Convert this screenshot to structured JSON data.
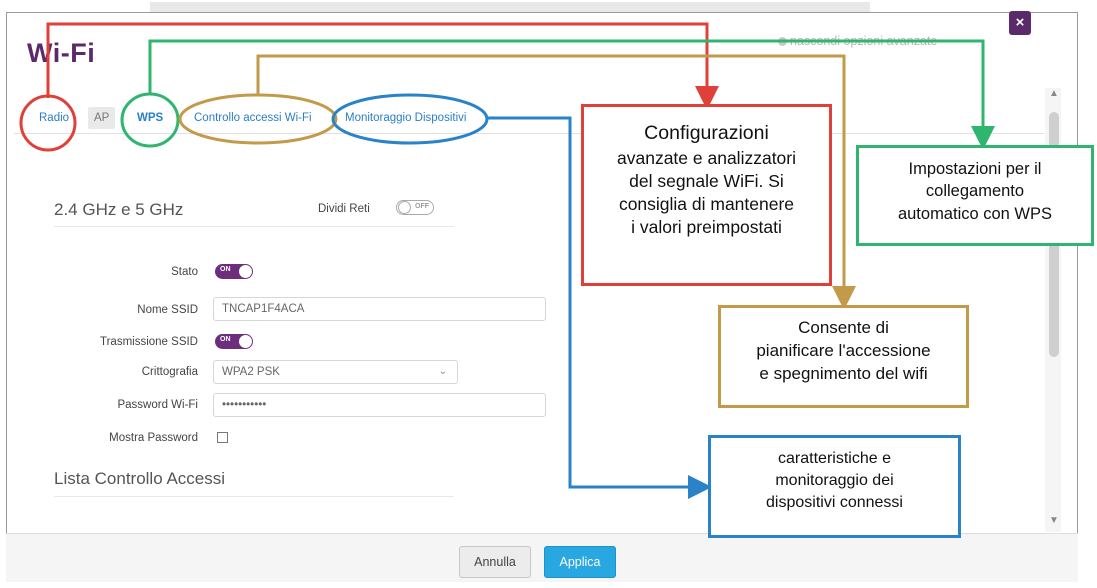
{
  "modal": {
    "title": "Wi-Fi",
    "advanced_link": "nascondi opzioni avanzate",
    "close_glyph": "×"
  },
  "tabs": [
    {
      "label": "Radio"
    },
    {
      "label": "AP"
    },
    {
      "label": "WPS"
    },
    {
      "label": "Controllo accessi Wi-Fi"
    },
    {
      "label": "Monitoraggio Dispositivi"
    }
  ],
  "form": {
    "band_title": "2.4 GHz e 5 GHz",
    "split_networks": {
      "label": "Dividi Reti",
      "state": "OFF"
    },
    "status": {
      "label": "Stato",
      "state": "ON"
    },
    "ssid_name": {
      "label": "Nome SSID",
      "value": "TNCAP1F4ACA"
    },
    "ssid_broadcast": {
      "label": "Trasmissione SSID",
      "state": "ON"
    },
    "encryption": {
      "label": "Crittografia",
      "value": "WPA2 PSK"
    },
    "password": {
      "label": "Password Wi-Fi",
      "value": "•••••••••••"
    },
    "show_password": {
      "label": "Mostra Password",
      "checked": false
    },
    "acl_title": "Lista Controllo Accessi"
  },
  "footer": {
    "cancel_label": "Annulla",
    "apply_label": "Applica"
  },
  "annotations": {
    "red": {
      "color": "#e0403a",
      "lines": [
        "Configurazioni",
        "avanzate e analizzatori",
        "del segnale WiFi. Si",
        "consiglia di mantenere",
        "i valori preimpostati"
      ]
    },
    "green": {
      "color": "#2fb56e",
      "lines": [
        "Impostazioni per il",
        "collegamento",
        "automatico con WPS"
      ]
    },
    "gold": {
      "color": "#c29a49",
      "lines": [
        "Consente di",
        "pianificare l'accessione",
        "e spegnimento del wifi"
      ]
    },
    "blue": {
      "color": "#2a82c8",
      "lines": [
        "caratteristiche e",
        "monitoraggio  dei",
        "dispositivi  connessi"
      ]
    }
  },
  "colors": {
    "brand": "#5a2a6a",
    "toggle_on": "#6d2e7d",
    "link": "#2a7fc5",
    "apply": "#29a7e0"
  },
  "icons": {
    "close": "close-icon",
    "select_caret": "chevron-down-icon",
    "scroll_up": "chevron-up-icon",
    "scroll_down": "chevron-down-icon"
  }
}
